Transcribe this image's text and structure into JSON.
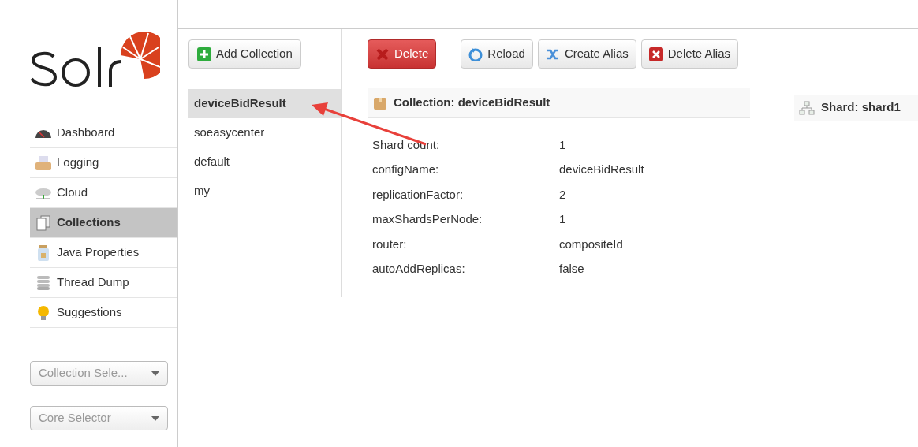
{
  "nav": [
    {
      "label": "Dashboard",
      "kind": "dashboard",
      "selected": false
    },
    {
      "label": "Logging",
      "kind": "logging",
      "selected": false
    },
    {
      "label": "Cloud",
      "kind": "cloud",
      "selected": false
    },
    {
      "label": "Collections",
      "kind": "collections",
      "selected": true
    },
    {
      "label": "Java Properties",
      "kind": "java",
      "selected": false
    },
    {
      "label": "Thread Dump",
      "kind": "threads",
      "selected": false
    },
    {
      "label": "Suggestions",
      "kind": "suggestions",
      "selected": false
    }
  ],
  "selectors": [
    {
      "placeholder": "Collection Sele..."
    },
    {
      "placeholder": "Core Selector"
    }
  ],
  "add_button": "Add Collection",
  "collections": [
    {
      "name": "deviceBidResult",
      "selected": true
    },
    {
      "name": "soeasycenter",
      "selected": false
    },
    {
      "name": "default",
      "selected": false
    },
    {
      "name": "my",
      "selected": false
    }
  ],
  "actions": [
    {
      "label": "Delete",
      "kind": "delete"
    },
    {
      "label": "Reload",
      "kind": "reload"
    },
    {
      "label": "Create Alias",
      "kind": "create-alias"
    },
    {
      "label": "Delete Alias",
      "kind": "delete-alias"
    }
  ],
  "collection_title": "Collection: deviceBidResult",
  "properties": [
    {
      "key": "Shard count:",
      "value": "1"
    },
    {
      "key": "configName:",
      "value": "deviceBidResult"
    },
    {
      "key": "replicationFactor:",
      "value": "2"
    },
    {
      "key": "maxShardsPerNode:",
      "value": "1"
    },
    {
      "key": "router:",
      "value": "compositeId"
    },
    {
      "key": "autoAddReplicas:",
      "value": "false"
    }
  ],
  "shard_title": "Shard: shard1",
  "annotation": {
    "kind": "arrow"
  }
}
